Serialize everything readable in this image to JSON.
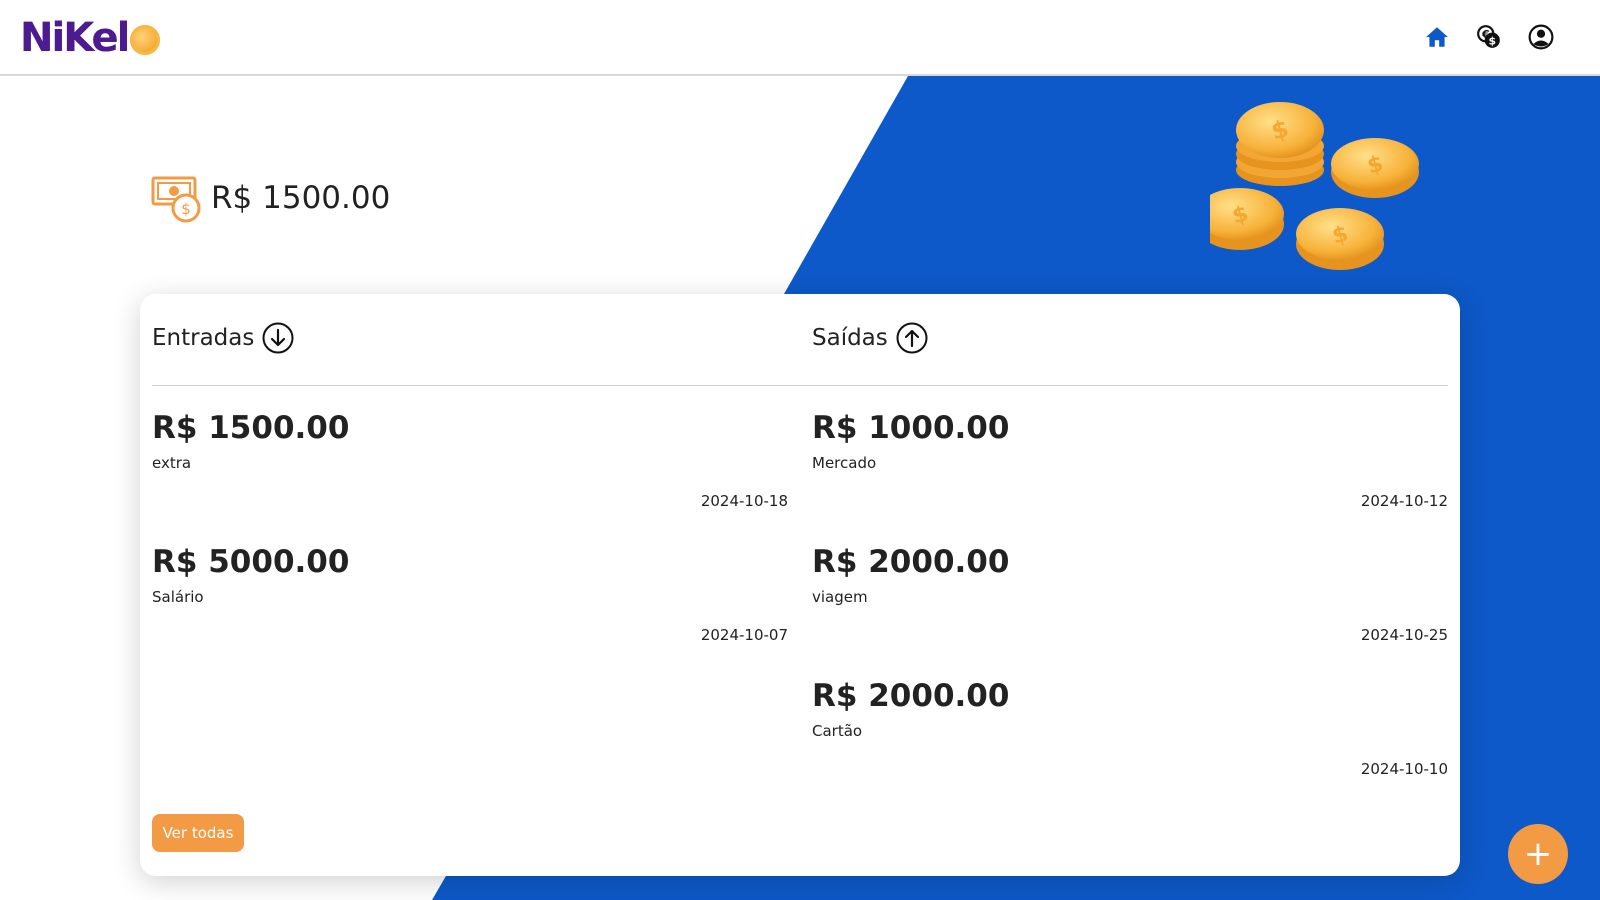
{
  "header": {
    "logo_text": "NiKel",
    "icons": [
      "home-icon",
      "transactions-icon",
      "account-icon"
    ]
  },
  "balance": {
    "value": "R$ 1500.00"
  },
  "entradas": {
    "title": "Entradas",
    "items": [
      {
        "amount": "R$ 1500.00",
        "description": "extra",
        "date": "2024-10-18"
      },
      {
        "amount": "R$ 5000.00",
        "description": "Salário",
        "date": "2024-10-07"
      }
    ]
  },
  "saidas": {
    "title": "Saídas",
    "items": [
      {
        "amount": "R$ 1000.00",
        "description": "Mercado",
        "date": "2024-10-12"
      },
      {
        "amount": "R$ 2000.00",
        "description": "viagem",
        "date": "2024-10-25"
      },
      {
        "amount": "R$ 2000.00",
        "description": "Cartão",
        "date": "2024-10-10"
      }
    ]
  },
  "actions": {
    "see_all_label": "Ver todas",
    "add_label": "+"
  },
  "colors": {
    "brand_blue": "#0d59c9",
    "accent_orange": "#f39a44",
    "logo_purple": "#4b1b8f"
  }
}
